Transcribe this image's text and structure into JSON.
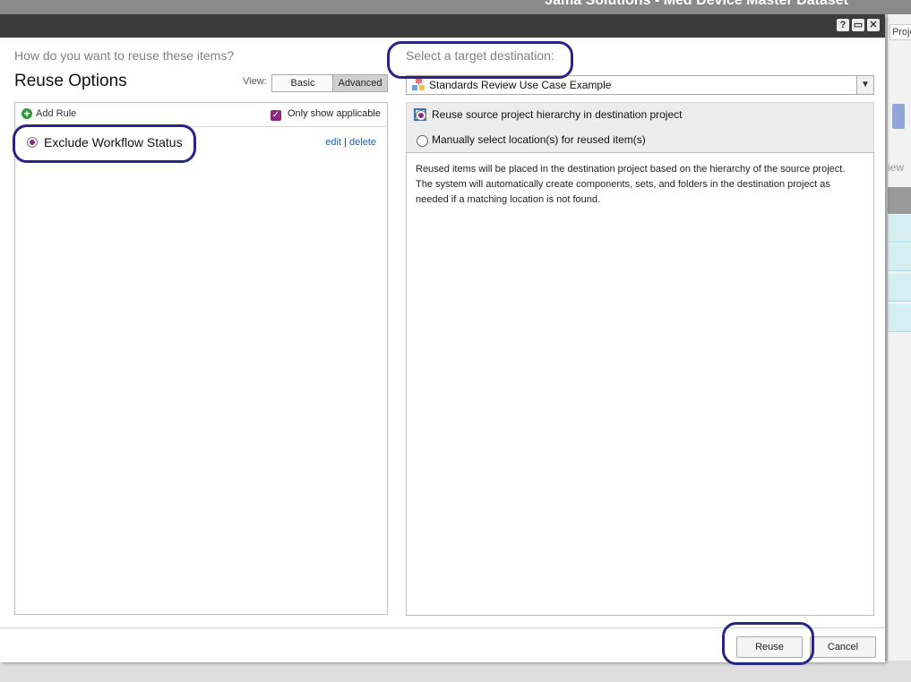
{
  "app": {
    "title": "Jama Solutions - Med Device Master Dataset"
  },
  "background": {
    "tab_label": "Proje",
    "view_label": "iew"
  },
  "window_controls": {
    "help": "?",
    "maximize": "▭",
    "close": "✕"
  },
  "reuse": {
    "question": "How do you want to reuse these items?",
    "title": "Reuse Options",
    "view_label": "View:",
    "view_basic": "Basic",
    "view_advanced": "Advanced",
    "view_selected": "Advanced",
    "add_rule": "Add Rule",
    "only_show_applicable": "Only show applicable",
    "only_show_applicable_checked": true,
    "rules": [
      {
        "label": "Exclude Workflow Status",
        "selected": true,
        "edit": "edit",
        "separator": "|",
        "delete": "delete"
      }
    ]
  },
  "destination": {
    "prompt": "Select a target destination:",
    "selected_project": "Standards Review Use Case Example",
    "options": [
      {
        "label": "Reuse source project hierarchy in destination project",
        "selected": true
      },
      {
        "label": "Manually select location(s) for reused item(s)",
        "selected": false
      }
    ],
    "description": "Reused items will be placed in the destination project based on the hierarchy of the source project. The system will automatically create components, sets, and folders in the destination project as needed if a matching location is not found."
  },
  "footer": {
    "reuse_label": "Reuse",
    "cancel_label": "Cancel"
  },
  "colors": {
    "accent_purple": "#8c2a80",
    "highlight": "#2a2486",
    "link": "#1f5fa8",
    "titlebar": "#3b3b3b"
  }
}
